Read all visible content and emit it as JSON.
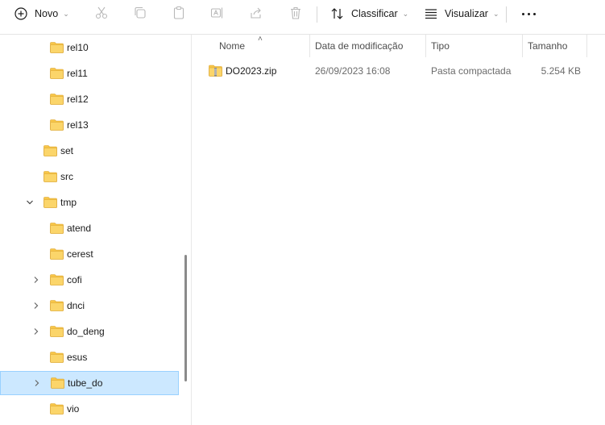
{
  "toolbar": {
    "new_label": "Novo",
    "sort_label": "Classificar",
    "view_label": "Visualizar",
    "icons": [
      "plus-circle-icon",
      "cut-icon",
      "copy-icon",
      "paste-icon",
      "rename-icon",
      "share-icon",
      "delete-icon",
      "sort-icon",
      "view-icon",
      "more-icon"
    ]
  },
  "nav": {
    "items": [
      {
        "label": "rel10",
        "expander": false
      },
      {
        "label": "rel11",
        "expander": false
      },
      {
        "label": "rel12",
        "expander": false
      },
      {
        "label": "rel13",
        "expander": false
      },
      {
        "label": "set",
        "expander": false
      },
      {
        "label": "src",
        "expander": false
      },
      {
        "label": "tmp",
        "expander": "expanded"
      },
      {
        "label": "atend",
        "expander": false
      },
      {
        "label": "cerest",
        "expander": false
      },
      {
        "label": "cofi",
        "expander": "collapsed"
      },
      {
        "label": "dnci",
        "expander": "collapsed"
      },
      {
        "label": "do_deng",
        "expander": "collapsed"
      },
      {
        "label": "esus",
        "expander": false
      },
      {
        "label": "tube_do",
        "expander": "collapsed",
        "selected": true
      },
      {
        "label": "vio",
        "expander": false
      }
    ]
  },
  "columns": {
    "name": "Nome",
    "modified": "Data de modificação",
    "type": "Tipo",
    "size": "Tamanho"
  },
  "files": [
    {
      "name": "DO2023.zip",
      "modified": "26/09/2023 16:08",
      "type": "Pasta compactada",
      "size": "5.254 KB"
    }
  ],
  "colors": {
    "folder": "#f8c648",
    "selection": "#cce8ff",
    "selection_border": "#99d1ff"
  }
}
